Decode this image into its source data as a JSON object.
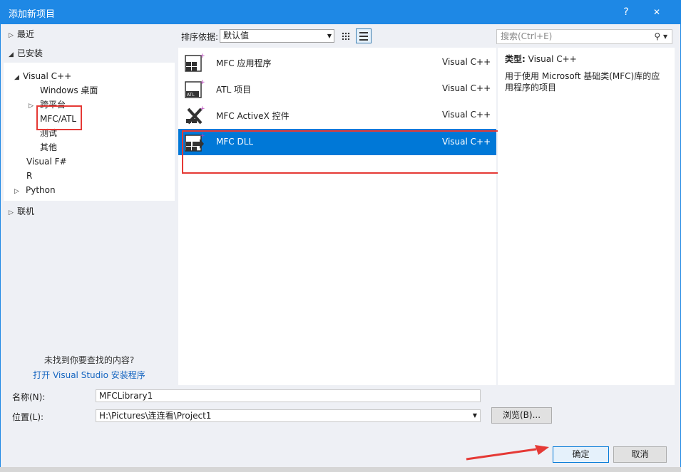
{
  "window": {
    "title": "添加新项目",
    "help": "?",
    "close": "✕"
  },
  "tree": {
    "recent": "最近",
    "installed": "已安装",
    "vcpp": "Visual C++",
    "windows_desktop": "Windows 桌面",
    "cross_platform": "跨平台",
    "mfc_atl": "MFC/ATL",
    "test": "测试",
    "other": "其他",
    "vfsharp": "Visual F#",
    "r": "R",
    "python": "Python",
    "online": "联机"
  },
  "not_found": "未找到你要查找的内容?",
  "install_link": "打开 Visual Studio 安装程序",
  "sort": {
    "label": "排序依据:",
    "value": "默认值"
  },
  "search": {
    "placeholder": "搜索(Ctrl+E)"
  },
  "templates": [
    {
      "name": "MFC 应用程序",
      "lang": "Visual C++",
      "icon": "mfc-app-icon"
    },
    {
      "name": "ATL 项目",
      "lang": "Visual C++",
      "icon": "atl-project-icon"
    },
    {
      "name": "MFC ActiveX 控件",
      "lang": "Visual C++",
      "icon": "mfc-activex-icon"
    },
    {
      "name": "MFC DLL",
      "lang": "Visual C++",
      "icon": "mfc-dll-icon"
    }
  ],
  "selected_index": 3,
  "details": {
    "type_label": "类型:",
    "type_value": "Visual C++",
    "description": "用于使用 Microsoft 基础类(MFC)库的应用程序的项目"
  },
  "form": {
    "name_label": "名称(N):",
    "name_value": "MFCLibrary1",
    "location_label": "位置(L):",
    "location_value": "H:\\Pictures\\连连看\\Project1",
    "browse": "浏览(B)..."
  },
  "buttons": {
    "ok": "确定",
    "cancel": "取消"
  },
  "colors": {
    "titlebar": "#1e88e5",
    "selection": "#0078d7",
    "annotation": "#e53935"
  }
}
